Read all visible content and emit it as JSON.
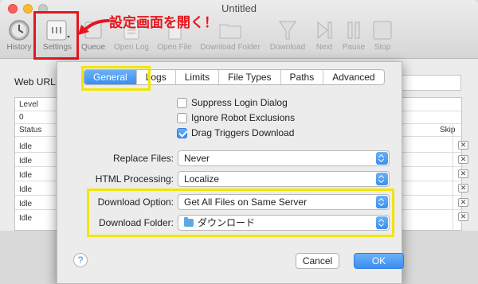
{
  "window": {
    "title": "Untitled"
  },
  "toolbar": {
    "items": [
      {
        "label": "History",
        "icon": "clock-icon"
      },
      {
        "label": "Settings",
        "icon": "settings-panel-icon"
      },
      {
        "label": "Queue",
        "icon": "queue-icon"
      },
      {
        "label": "Open Log",
        "icon": "log-icon"
      },
      {
        "label": "Open File",
        "icon": "file-icon"
      },
      {
        "label": "Download Folder",
        "icon": "folder-icon"
      },
      {
        "label": "Download",
        "icon": "download-funnel-icon"
      },
      {
        "label": "Next",
        "icon": "next-icon"
      },
      {
        "label": "Pause",
        "icon": "pause-icon"
      },
      {
        "label": "Stop",
        "icon": "stop-icon"
      }
    ]
  },
  "annotation": {
    "callout": "設定画面を開く！",
    "highlight_color": "#e5161d",
    "box_color": "#f2e600"
  },
  "main": {
    "web_url_label": "Web URL:",
    "table": {
      "level_header": "Level",
      "level_value": "0",
      "status_header": "Status",
      "skip_header": "Skip",
      "rows": [
        "Idle",
        "Idle",
        "Idle",
        "Idle",
        "Idle",
        "Idle"
      ],
      "skip_mark": "✕"
    }
  },
  "dialog": {
    "tabs": [
      "General",
      "Logs",
      "Limits",
      "File Types",
      "Paths",
      "Advanced"
    ],
    "selected_tab": "General",
    "checkboxes": [
      {
        "label": "Suppress Login Dialog",
        "checked": false
      },
      {
        "label": "Ignore Robot Exclusions",
        "checked": false
      },
      {
        "label": "Drag Triggers Download",
        "checked": true
      }
    ],
    "fields": {
      "replace_files": {
        "label": "Replace Files:",
        "value": "Never"
      },
      "html_processing": {
        "label": "HTML Processing:",
        "value": "Localize"
      },
      "download_option": {
        "label": "Download Option:",
        "value": "Get All Files on Same Server"
      },
      "download_folder": {
        "label": "Download Folder:",
        "value": "ダウンロード"
      }
    },
    "help": "?",
    "cancel": "Cancel",
    "ok": "OK"
  },
  "colors": {
    "accent": "#3a8ef0"
  }
}
